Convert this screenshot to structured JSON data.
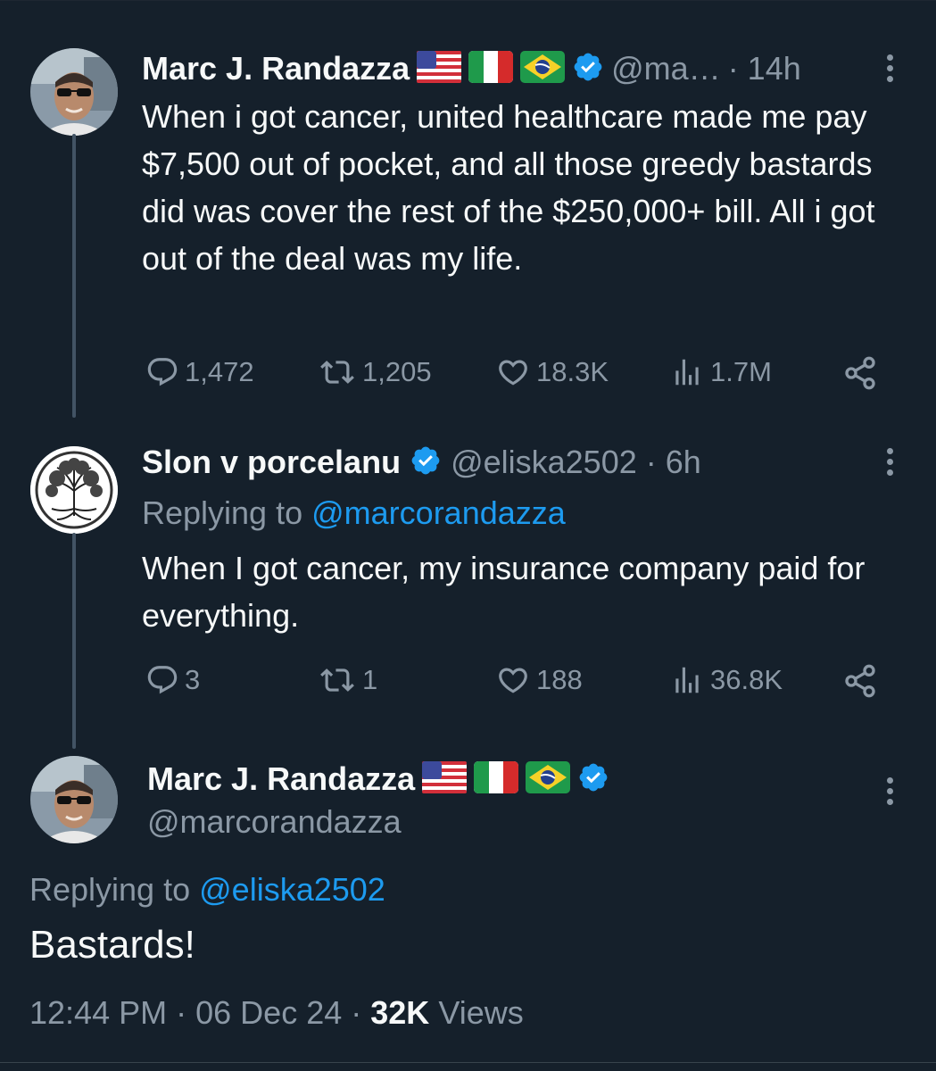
{
  "tweet1": {
    "name": "Marc J. Randazza",
    "handle": "@ma…",
    "time": "· 14h",
    "text": "When i got cancer, united healthcare made me pay $7,500 out of pocket, and all those greedy bastards did was cover the rest of the $250,000+ bill.  All i got out of the deal was my life.",
    "replies": "1,472",
    "reposts": "1,205",
    "likes": "18.3K",
    "views": "1.7M"
  },
  "tweet2": {
    "name": "Slon v porcelanu",
    "handle": "@eliska2502",
    "time": "· 6h",
    "replying_label": "Replying to",
    "replying_handle": "@marcorandazza",
    "text": "When I got cancer, my insurance company paid for everything.",
    "replies": "3",
    "reposts": "1",
    "likes": "188",
    "views": "36.8K"
  },
  "tweet3": {
    "name": "Marc J. Randazza",
    "handle": "@marcorandazza",
    "replying_label": "Replying to",
    "replying_handle": "@eliska2502",
    "text": "Bastards!",
    "time": "12:44 PM",
    "date": "06 Dec 24",
    "views_count": "32K",
    "views_label": "Views"
  },
  "colors": {
    "background": "#15202b",
    "text": "#f7f9f9",
    "muted": "#8b98a5",
    "accent": "#1d9bf0"
  },
  "icons": [
    "more-icon",
    "verified-icon",
    "reply-icon",
    "repost-icon",
    "like-icon",
    "views-icon",
    "share-icon",
    "flag-us-icon",
    "flag-it-icon",
    "flag-br-icon"
  ]
}
